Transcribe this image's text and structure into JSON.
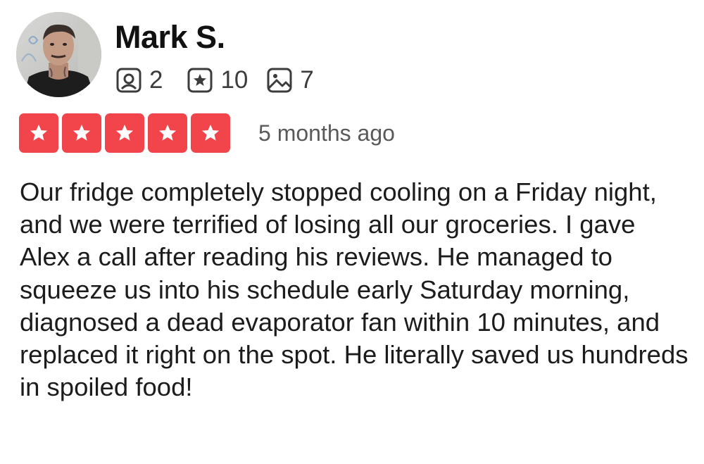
{
  "reviewer": {
    "name": "Mark S.",
    "avatar_icon": "person-avatar-photo",
    "stats": {
      "reviews": "2",
      "stars": "10",
      "photos": "7"
    }
  },
  "rating": {
    "stars_filled": 5,
    "stars_total": 5,
    "star_color": "#f2454b",
    "date": "5 months ago"
  },
  "review": {
    "text": "Our fridge completely stopped cooling on a Friday night, and we were terrified of losing all our groceries. I gave Alex a call after reading his reviews. He managed to squeeze us into his schedule early Saturday morning, diagnosed a dead evaporator fan within 10 minutes, and replaced it right on the spot. He literally saved us hundreds in spoiled food!"
  },
  "icons": {
    "reviews": "review-bubble-icon",
    "stars": "star-square-icon",
    "photos": "photo-icon"
  }
}
